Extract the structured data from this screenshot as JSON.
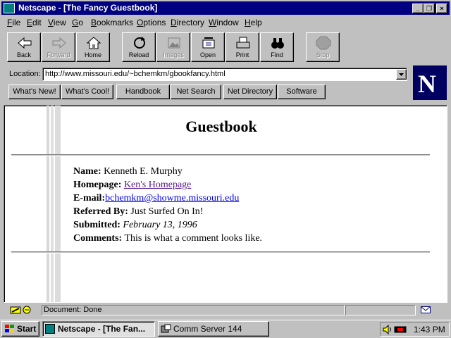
{
  "window": {
    "title": "Netscape - [The Fancy Guestbook]",
    "controls": [
      "_",
      "❒",
      "×"
    ]
  },
  "menu": [
    {
      "u": "F",
      "rest": "ile"
    },
    {
      "u": "E",
      "rest": "dit"
    },
    {
      "u": "V",
      "rest": "iew"
    },
    {
      "u": "G",
      "rest": "o"
    },
    {
      "u": "B",
      "rest": "ookmarks"
    },
    {
      "u": "O",
      "rest": "ptions"
    },
    {
      "u": "D",
      "rest": "irectory"
    },
    {
      "u": "W",
      "rest": "indow"
    },
    {
      "u": "H",
      "rest": "elp"
    }
  ],
  "toolbar": {
    "back": "Back",
    "forward": "Forward",
    "home": "Home",
    "reload": "Reload",
    "images": "Images",
    "open": "Open",
    "print": "Print",
    "find": "Find",
    "stop": "Stop"
  },
  "location": {
    "label": "Location:",
    "url": "http://www.missouri.edu/~bchemkm/gbookfancy.html"
  },
  "directory_buttons": {
    "whats_new": "What's New!",
    "whats_cool": "What's Cool!",
    "handbook": "Handbook",
    "net_search": "Net Search",
    "net_directory": "Net Directory",
    "software": "Software"
  },
  "logo_letter": "N",
  "page": {
    "heading": "Guestbook",
    "name_label": "Name:",
    "name_value": "Kenneth E. Murphy",
    "homepage_label": "Homepage:",
    "homepage_value": "Ken's Homepage",
    "email_label": "E-mail:",
    "email_value": "bchemkm@showme.missouri.edu",
    "referred_label": "Referred By:",
    "referred_value": "Just Surfed On In!",
    "submitted_label": "Submitted:",
    "submitted_value": "February 13, 1996",
    "comments_label": "Comments:",
    "comments_value": "This is what a comment looks like."
  },
  "status": {
    "text": "Document: Done"
  },
  "taskbar": {
    "start": "Start",
    "task1": "Netscape - [The Fan...",
    "task2": "Comm Server 144",
    "clock": "1:43 PM"
  },
  "colors": {
    "titlebar": "#000080",
    "visited_link": "#551a8b",
    "link": "#0000ee",
    "chrome": "#c0c0c0"
  }
}
